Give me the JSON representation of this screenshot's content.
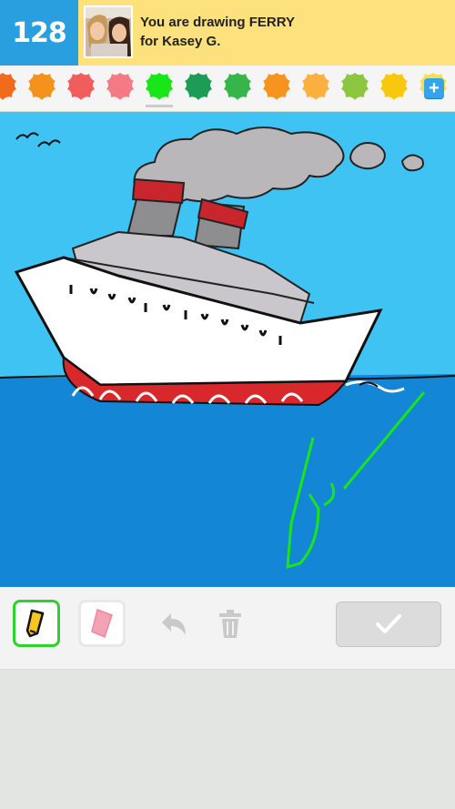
{
  "header": {
    "score": "128",
    "prompt_line1": "You are drawing FERRY",
    "prompt_line2": "for Kasey G.",
    "avatar": "friend-avatar-photo"
  },
  "palette": {
    "colors": [
      "#f26b1d",
      "#f5921e",
      "#f15c5c",
      "#f47b86",
      "#19e619",
      "#1c9c55",
      "#36b54a",
      "#f7941d",
      "#fbb040",
      "#8dc63f",
      "#f7c80d",
      "#f4e04d"
    ],
    "selected_index": 4,
    "add_button": "+"
  },
  "canvas": {
    "sky_color": "#3fc3f3",
    "sea_color": "#1486d6",
    "subject": "ferry-drawing"
  },
  "toolbar": {
    "pencil": "pencil-icon",
    "eraser": "eraser-icon",
    "undo": "undo-icon",
    "trash": "trash-icon",
    "done": "checkmark-icon",
    "active_color": "#2ed12e"
  }
}
